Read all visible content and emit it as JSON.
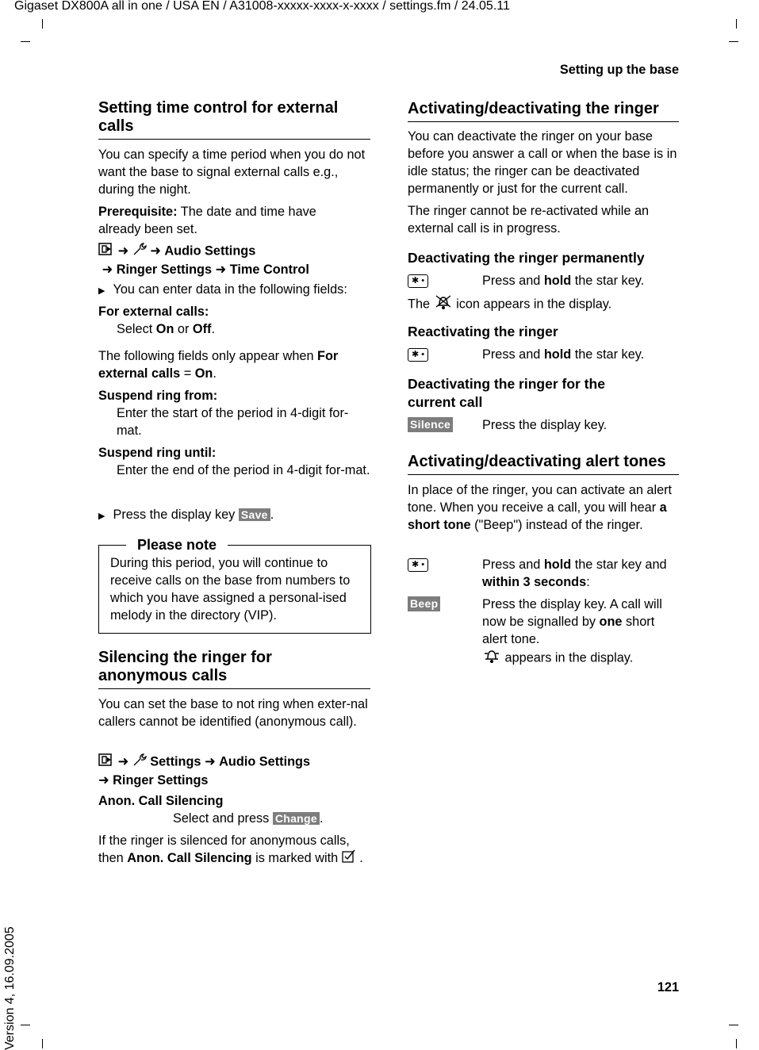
{
  "header": {
    "doc_info": "Gigaset DX800A all in one / USA EN / A31008-xxxxx-xxxx-x-xxxx / settings.fm / 24.05.11",
    "section": "Setting up the base",
    "page_number": "121",
    "version": "Version 4, 16.09.2005"
  },
  "left": {
    "s1": {
      "title": "Setting time control for external calls",
      "intro": "You can specify a time period when you do not want the base to signal external calls e.g., during the night.",
      "prereq": [
        {
          "t": "Prerequisite:",
          "s": "b"
        },
        {
          "t": " The date and time have already been set."
        }
      ],
      "menu": [
        {
          "t": "menu-key-icon",
          "s": "icon"
        },
        {
          "t": " ➜ "
        },
        {
          "t": "wrench-icon",
          "s": "icon"
        },
        {
          "t": " ➜ "
        },
        {
          "t": "Audio Settings",
          "s": "b"
        },
        {
          "t": "\n ➜ "
        },
        {
          "t": "Ringer Settings",
          "s": "b"
        },
        {
          "t": " ➜ "
        },
        {
          "t": "Time Control",
          "s": "b"
        }
      ],
      "step1": "You can enter data in the following fields:",
      "f1_label": "For external calls:",
      "f1_text": [
        {
          "t": "Select "
        },
        {
          "t": "On",
          "s": "b"
        },
        {
          "t": " or "
        },
        {
          "t": "Off",
          "s": "b"
        },
        {
          "t": "."
        }
      ],
      "cond": [
        {
          "t": "The following fields only appear when "
        },
        {
          "t": "For external calls",
          "s": "b"
        },
        {
          "t": " = "
        },
        {
          "t": "On",
          "s": "b"
        },
        {
          "t": "."
        }
      ],
      "f2_label": "Suspend ring from:",
      "f2_text": "Enter the start of the period in 4-digit for-mat.",
      "f3_label": "Suspend ring until:",
      "f3_text": "Enter the end of the period in 4-digit for-mat.",
      "step2": [
        {
          "t": "Press the display key "
        },
        {
          "t": "Save",
          "s": "key"
        },
        {
          "t": "."
        }
      ]
    },
    "note": {
      "title": "Please note",
      "text": "During this period, you will continue to receive calls on the base from numbers to which you have assigned a personal-ised melody in the directory (VIP)."
    },
    "s2": {
      "title": "Silencing the ringer for anonymous calls",
      "intro": "You can set the base to not ring when exter-nal callers cannot be identified (anonymous call).",
      "menu": [
        {
          "t": "menu-key-icon",
          "s": "icon"
        },
        {
          "t": " ➜ "
        },
        {
          "t": "wrench-icon",
          "s": "icon"
        },
        {
          "t": " Settings",
          "s": "b"
        },
        {
          "t": " ➜ "
        },
        {
          "t": "Audio Settings",
          "s": "b"
        },
        {
          "t": "\n➜ "
        },
        {
          "t": "Ringer Settings",
          "s": "b"
        }
      ],
      "field_label": "Anon. Call Silencing",
      "field_text": [
        {
          "t": "Select and press "
        },
        {
          "t": "Change",
          "s": "key"
        },
        {
          "t": "."
        }
      ],
      "outro": [
        {
          "t": "If the ringer is silenced for anonymous calls, then "
        },
        {
          "t": "Anon. Call Silencing",
          "s": "b"
        },
        {
          "t": " is marked with "
        },
        {
          "t": "checkbox-icon",
          "s": "icon"
        },
        {
          "t": " ."
        }
      ]
    }
  },
  "right": {
    "s3": {
      "title": "Activating/deactivating the ringer",
      "p1": "You can deactivate the ringer on your base before you answer a call or when the base is in idle status; the ringer can be deactivated permanently or just for the current call.",
      "p2": "The ringer cannot be re-activated while an external call is in progress.",
      "h_perm": "Deactivating the ringer permanently",
      "perm_action": [
        {
          "t": "Press and "
        },
        {
          "t": "hold",
          "s": "b"
        },
        {
          "t": " the star key."
        }
      ],
      "perm_note": [
        {
          "t": "The "
        },
        {
          "t": "ringer-off-icon",
          "s": "icon"
        },
        {
          "t": " icon appears in the display."
        }
      ],
      "h_react": "Reactivating the ringer",
      "react_action": [
        {
          "t": "Press and "
        },
        {
          "t": "hold",
          "s": "b"
        },
        {
          "t": " the star key."
        }
      ],
      "h_current": "Deactivating the ringer for the current call",
      "current_key": "Silence",
      "current_action": "Press the display key."
    },
    "s4": {
      "title": "Activating/deactivating alert tones",
      "p1": [
        {
          "t": "In place of the ringer, you can activate an alert tone. When you receive a call, you will hear "
        },
        {
          "t": "a short tone",
          "s": "b"
        },
        {
          "t": " (\"Beep\") instead of the ringer."
        }
      ],
      "step1": [
        {
          "t": "Press and "
        },
        {
          "t": "hold",
          "s": "b"
        },
        {
          "t": " the star key and "
        },
        {
          "t": "within 3 seconds",
          "s": "b"
        },
        {
          "t": ":"
        }
      ],
      "beep_key": "Beep",
      "step2": [
        {
          "t": "Press the display key. A call will now be signalled by "
        },
        {
          "t": "one",
          "s": "b"
        },
        {
          "t": " short alert tone."
        },
        {
          "t": "\n"
        },
        {
          "t": "beep-icon",
          "s": "icon"
        },
        {
          "t": " appears in the display."
        }
      ]
    }
  },
  "star_key_label": "✱ •"
}
